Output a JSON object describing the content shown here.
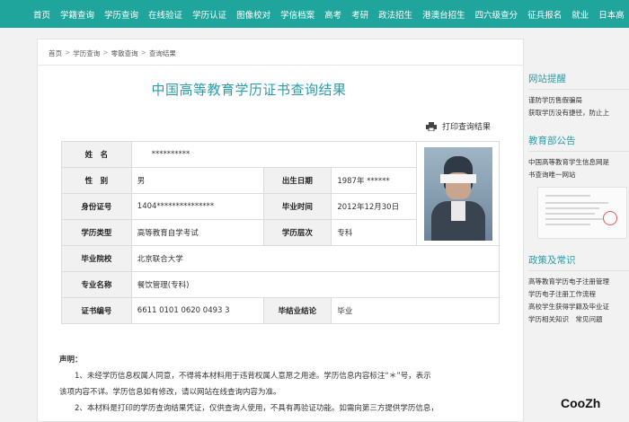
{
  "nav": [
    "首页",
    "学籍查询",
    "学历查询",
    "在线验证",
    "学历认证",
    "图像校对",
    "学信档案",
    "高考",
    "考研",
    "政法招生",
    "港澳台招生",
    "四六级查分",
    "征兵报名",
    "就业",
    "日本高"
  ],
  "breadcrumb": [
    "首页",
    "学历查询",
    "零散查询",
    "查询结果"
  ],
  "title": "中国高等教育学历证书查询结果",
  "print_label": "打印查询结果",
  "table": {
    "name_label": "姓　名",
    "name_value": "**********",
    "gender_label": "性　别",
    "gender_value": "男",
    "birth_label": "出生日期",
    "birth_value": "1987年 ******",
    "id_label": "身份证号",
    "id_value": "1404***************",
    "grad_time_label": "毕业时间",
    "grad_time_value": "2012年12月30日",
    "type_label": "学历类型",
    "type_value": "高等教育自学考试",
    "level_label": "学历层次",
    "level_value": "专科",
    "school_label": "毕业院校",
    "school_value": "北京联合大学",
    "major_label": "专业名称",
    "major_value": "餐饮管理(专科)",
    "cert_label": "证书编号",
    "cert_value": "6611 0101 0620 0493 3",
    "result_label": "毕结业结论",
    "result_value": "毕业"
  },
  "declaration": {
    "heading": "声明：",
    "p1": "1、未经学历信息权属人同意，不得将本材料用于违背权属人意愿之用途。学历信息内容标注“＊”号，表示",
    "p1b": "该项内容不详。学历信息如有修改，请以网站在线查询内容为准。",
    "p2": "2、本材料是打印的学历查询结果凭证，仅供查询人使用，不具有再验证功能。如需向第三方提供学历信息，"
  },
  "sidebar": {
    "s1_title": "网站提醒",
    "s1_lines": [
      "谨防学历售假骗局",
      "获取学历没有捷径，防止上"
    ],
    "s2_title": "教育部公告",
    "s2_lines": [
      "中国高等教育学生信息网是",
      "书查询唯一网站"
    ],
    "s3_title": "政策及常识",
    "s3_lines": [
      "高等教育学历电子注册管理",
      "学历电子注册工作流程",
      "高校学生获得学籍及毕业证",
      "学历相关知识　常见问题"
    ]
  },
  "watermark": "CooZh"
}
